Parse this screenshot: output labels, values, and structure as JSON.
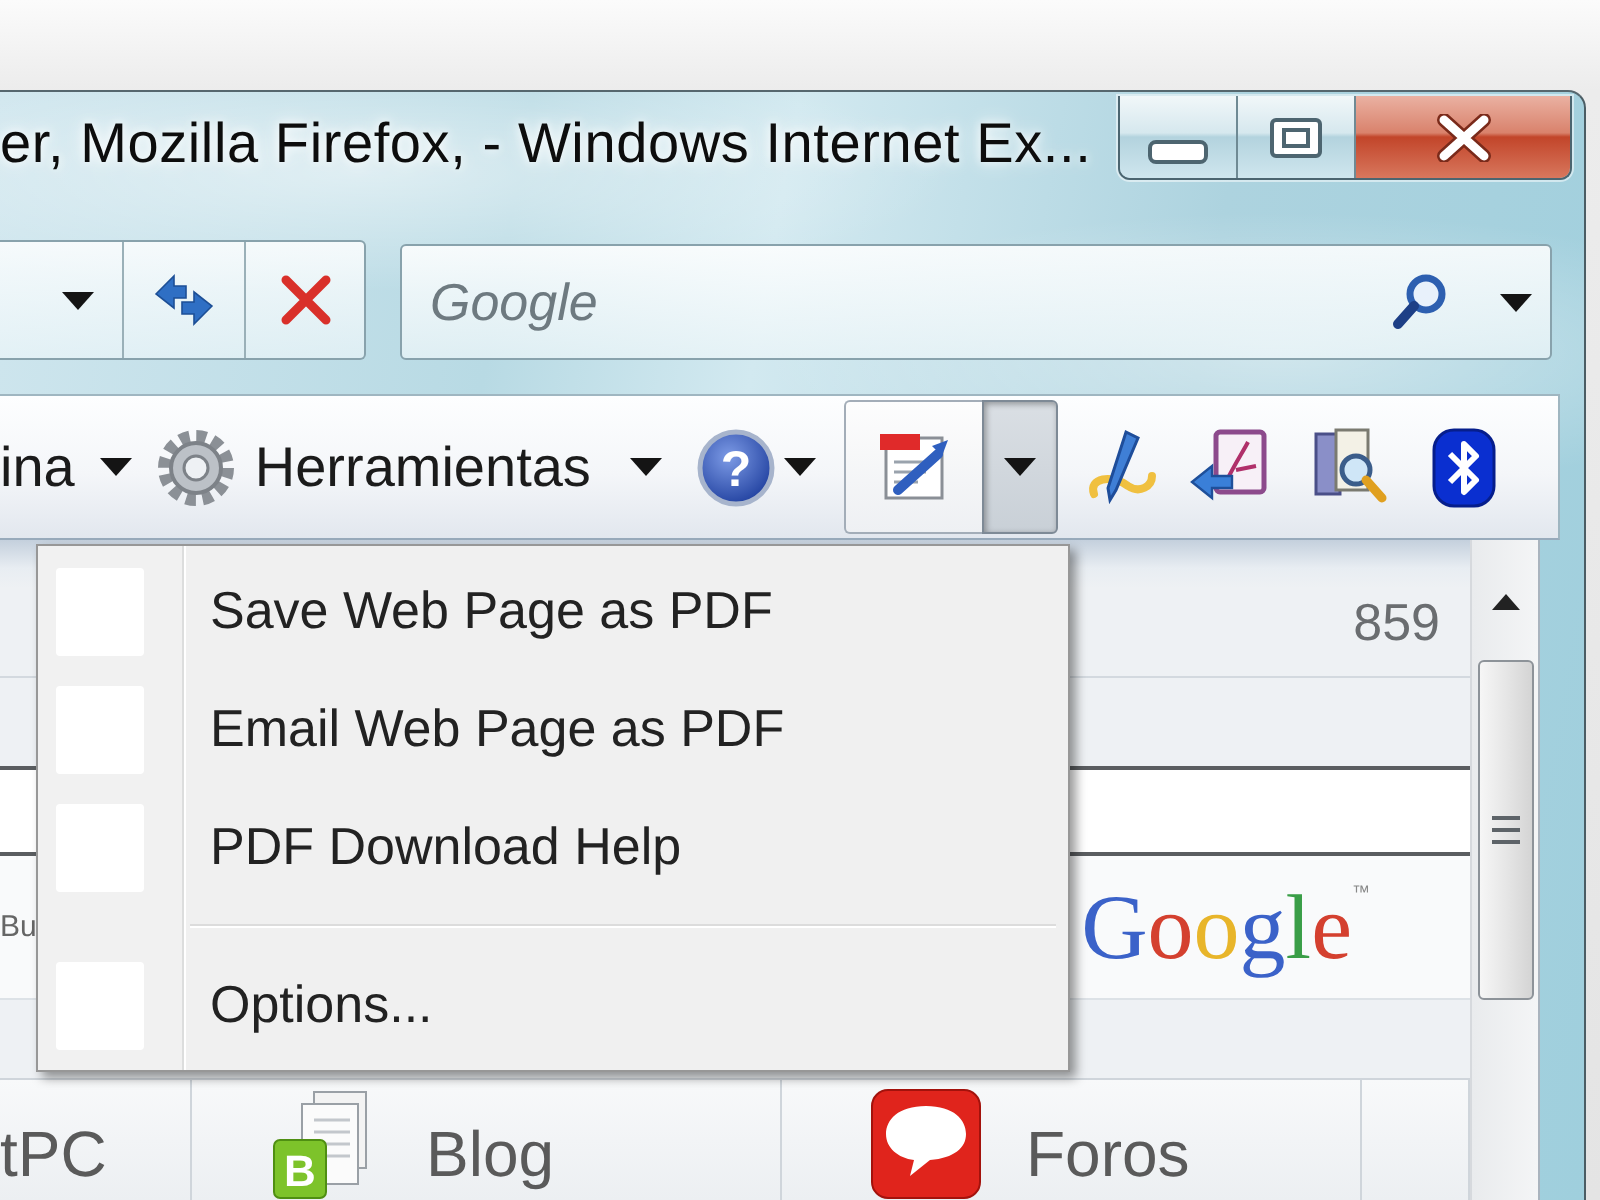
{
  "window": {
    "title": "er, Mozilla Firefox, - Windows Internet Ex..."
  },
  "navigation": {
    "search": {
      "placeholder": "Google"
    }
  },
  "command_bar": {
    "page_menu": {
      "label": "ina"
    },
    "tools_menu": {
      "label": "Herramientas"
    },
    "help_menu": {
      "glyph": "?"
    },
    "split_button": {
      "expanded": true
    }
  },
  "dropdown_menu": {
    "items": [
      {
        "kind": "item",
        "label": "Save Web Page as PDF"
      },
      {
        "kind": "item",
        "label": "Email Web Page as PDF"
      },
      {
        "kind": "item",
        "label": "PDF Download Help"
      },
      {
        "kind": "separator"
      },
      {
        "kind": "item",
        "label": "Options..."
      }
    ]
  },
  "page": {
    "counter": "859",
    "logo_row": {
      "fragment": "Bu",
      "logo": "Google",
      "logo_mark": "™"
    },
    "tabs": [
      {
        "kind": "plain",
        "label": "tPC"
      },
      {
        "kind": "blog",
        "label": "Blog",
        "badge": "B"
      },
      {
        "kind": "forum",
        "label": "Foros"
      }
    ]
  }
}
